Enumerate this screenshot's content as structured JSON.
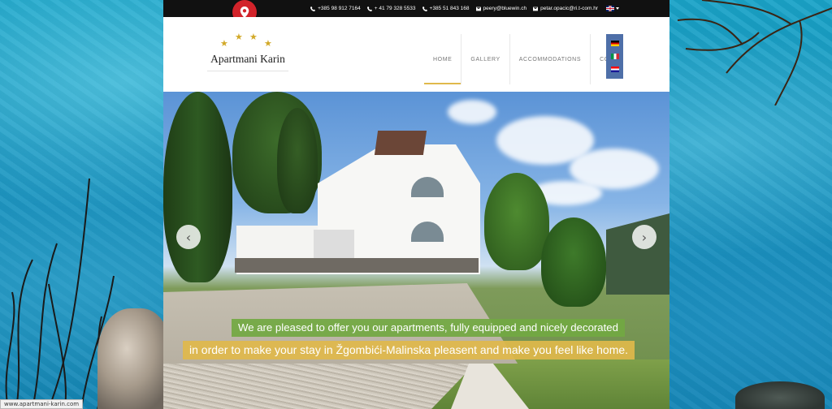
{
  "status_url": "www.apartmani-karin.com",
  "topbar": {
    "contacts": [
      {
        "icon": "phone-icon",
        "text": "+385 98 912 7164"
      },
      {
        "icon": "phone-icon",
        "text": "+ 41 79 328 5533"
      },
      {
        "icon": "phone-icon",
        "text": "+385 51 843 168"
      },
      {
        "icon": "mail-icon",
        "text": "peery@bluewin.ch"
      },
      {
        "icon": "mail-icon",
        "text": "petar.opacic@ri.t-com.hr"
      }
    ],
    "current_language": "en"
  },
  "logo": {
    "name": "Apartmani Karin",
    "stars": "★",
    "star_color": "#d2a928"
  },
  "nav": {
    "items": [
      {
        "label": "HOME",
        "active": true
      },
      {
        "label": "GALLERY",
        "active": false
      },
      {
        "label": "ACCOMMODATIONS",
        "active": false
      },
      {
        "label": "CONT",
        "active": false
      }
    ],
    "active_color": "#e0b94b"
  },
  "language_dropdown": [
    "de",
    "it",
    "hr"
  ],
  "hero": {
    "prev_arrow": "‹",
    "next_arrow": "›",
    "caption_1": "We are pleased to offer you our apartments, fully equipped and nicely decorated",
    "caption_2": "in order to make your stay in Žgombići-Malinska pleasent and make you feel like home.",
    "caption_1_color": "#72a842",
    "caption_2_color": "#e0b94b"
  },
  "colors": {
    "pin": "#d2232a",
    "topbar": "#111111",
    "sea": "#1591bd"
  }
}
